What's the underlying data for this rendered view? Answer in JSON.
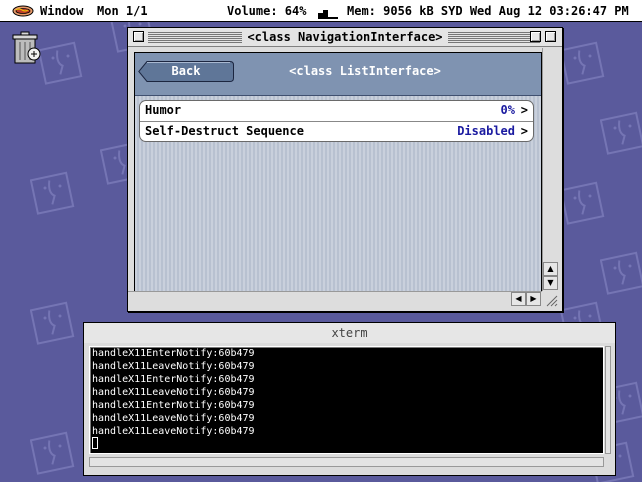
{
  "menubar": {
    "app_menu": "Window",
    "monitor": "Mon 1/1",
    "volume": "Volume: 64%",
    "status": "Mem: 9056 kB SYD Wed Aug 12 03:26:47 PM",
    "apple_icon": "hotdog-apple-icon"
  },
  "desktop": {
    "trash_icon": "trash-icon",
    "wallpaper_icon": "mac-os-face-icon"
  },
  "main_window": {
    "title": "<class NavigationInterface>",
    "nav": {
      "back_label": "Back",
      "title": "<class ListInterface>"
    },
    "rows": [
      {
        "label": "Humor",
        "value": "0%",
        "chevron": ">"
      },
      {
        "label": "Self-Destruct Sequence",
        "value": "Disabled",
        "chevron": ">"
      }
    ]
  },
  "xterm": {
    "title": "xterm",
    "lines": [
      "handleX11EnterNotify:60b479",
      "handleX11LeaveNotify:60b479",
      "handleX11EnterNotify:60b479",
      "handleX11LeaveNotify:60b479",
      "handleX11EnterNotify:60b479",
      "handleX11LeaveNotify:60b479",
      "handleX11LeaveNotify:60b479"
    ]
  },
  "colors": {
    "desktop": "#5a5a9c",
    "nav_bar": "#7f93b1",
    "value_text": "#1a1aa0",
    "terminal_bg": "#000000"
  }
}
